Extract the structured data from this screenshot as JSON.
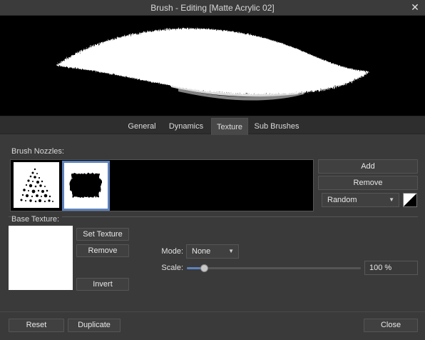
{
  "window": {
    "title": "Brush - Editing [Matte Acrylic 02]",
    "close_glyph": "✕",
    "close_icon": "close-icon"
  },
  "tabs": [
    {
      "label": "General",
      "active": false
    },
    {
      "label": "Dynamics",
      "active": false
    },
    {
      "label": "Texture",
      "active": true
    },
    {
      "label": "Sub Brushes",
      "active": false
    }
  ],
  "nozzles": {
    "label": "Brush Nozzles:",
    "items": [
      {
        "name": "nozzle-dots",
        "selected": false
      },
      {
        "name": "nozzle-acrylic-stroke",
        "selected": true
      }
    ],
    "add_label": "Add",
    "remove_label": "Remove",
    "order_value": "Random",
    "swatch_icon": "color-swatch-icon"
  },
  "base_texture": {
    "label": "Base Texture:",
    "set_texture_label": "Set Texture",
    "remove_label": "Remove",
    "invert_label": "Invert",
    "mode_label": "Mode:",
    "mode_value": "None",
    "scale_label": "Scale:",
    "scale_value": "100 %",
    "scale_fraction": 0.1
  },
  "footer": {
    "reset_label": "Reset",
    "duplicate_label": "Duplicate",
    "close_label": "Close"
  },
  "colors": {
    "accent": "#5d82bc",
    "background": "#3a3a3a",
    "preview_bg": "#000000"
  }
}
